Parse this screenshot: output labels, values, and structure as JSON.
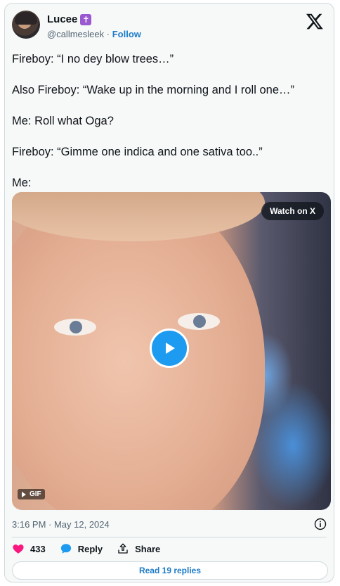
{
  "author": {
    "display_name": "Lucee",
    "badge": "✝",
    "handle": "@callmesleek",
    "separator": "·",
    "follow_label": "Follow"
  },
  "tweet": {
    "lines": [
      "Fireboy: “I no dey blow trees…”",
      "Also Fireboy: “Wake up in the morning and I roll one…”",
      "Me: Roll what Oga?",
      "Fireboy: “Gimme one indica and one sativa too..”",
      "Me:"
    ]
  },
  "media": {
    "watch_label": "Watch on X",
    "gif_label": "GIF",
    "icons": {
      "play": "play-icon",
      "gif": "gif-play-icon"
    }
  },
  "timestamp": "3:16 PM · May 12, 2024",
  "actions": {
    "like_count": "433",
    "reply_label": "Reply",
    "share_label": "Share"
  },
  "read_replies_label": "Read 19 replies",
  "colors": {
    "like": "#f91880",
    "reply": "#1d9bf0",
    "link": "#1d7bc8",
    "muted": "#536471"
  }
}
